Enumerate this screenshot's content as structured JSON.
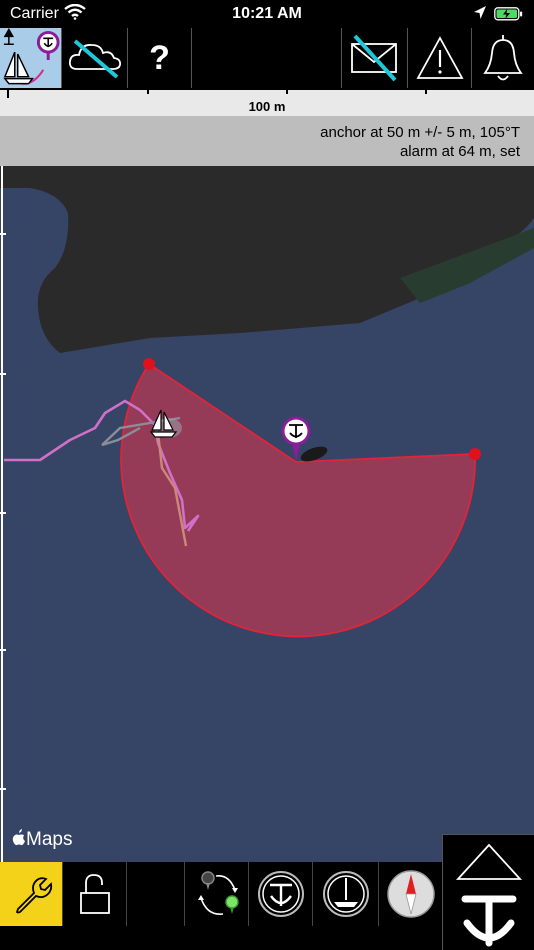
{
  "status_bar": {
    "carrier": "Carrier",
    "time": "10:21 AM"
  },
  "toolbar": {
    "icons": [
      "boat-anchor-mode-icon",
      "weather-disabled-icon",
      "help-icon",
      "messages-disabled-icon",
      "warning-icon",
      "alarm-bell-icon"
    ],
    "help_label": "?"
  },
  "map": {
    "scale_label": "100 m",
    "info_line1": "anchor at 50 m +/- 5 m, 105°T",
    "info_line2": "alarm at 64 m, set",
    "attribution": "Maps",
    "colors": {
      "water": "#364466",
      "land": "#2a2a2a",
      "alarm_zone": "#a33a55",
      "alarm_border": "#e0243a",
      "track": "#d070c8"
    }
  },
  "bottom_bar": {
    "icons": [
      "settings-wrench-icon",
      "unlock-icon",
      "empty-slot",
      "swap-markers-icon",
      "anchor-center-icon",
      "boat-center-icon",
      "compass-icon"
    ]
  },
  "anchor_panel": {
    "icons": [
      "raise-triangle-icon",
      "anchor-icon"
    ]
  }
}
